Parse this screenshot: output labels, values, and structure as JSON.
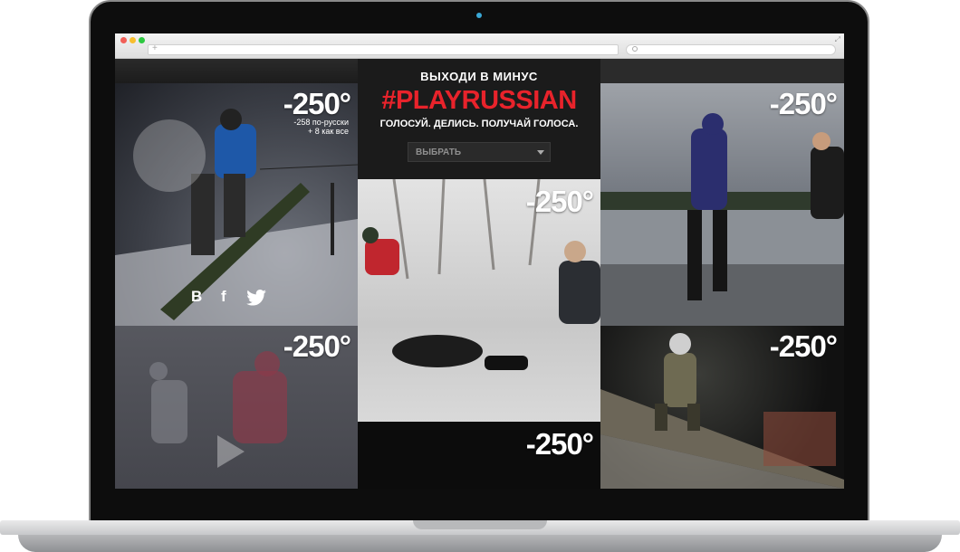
{
  "promo": {
    "heading": "ВЫХОДИ В МИНУС",
    "hashtag": "#PLAYRUSSIAN",
    "tagline": "ГОЛОСУЙ. ДЕЛИСЬ. ПОЛУЧАЙ ГОЛОСА.",
    "select_value": "ВЫБРАТЬ"
  },
  "tiles": {
    "snowboard": {
      "degree": "-250°",
      "sub_line1": "-258 по-русски",
      "sub_line2": "+ 8 как все"
    },
    "hockey": {
      "degree": "-250°"
    },
    "snow_fall": {
      "degree": "-250°"
    },
    "dark_bottom": {
      "degree": "-250°"
    },
    "runners": {
      "degree": "-250°"
    },
    "rail": {
      "degree": "-250°"
    }
  },
  "social": {
    "vk": "B",
    "facebook": "f"
  },
  "icons": [
    "vk-icon",
    "facebook-icon",
    "twitter-icon",
    "play-icon",
    "search-icon",
    "dropdown-caret-icon"
  ],
  "colors": {
    "accent_red": "#e8232b",
    "bg_dark": "#151515",
    "text_white": "#ffffff"
  }
}
